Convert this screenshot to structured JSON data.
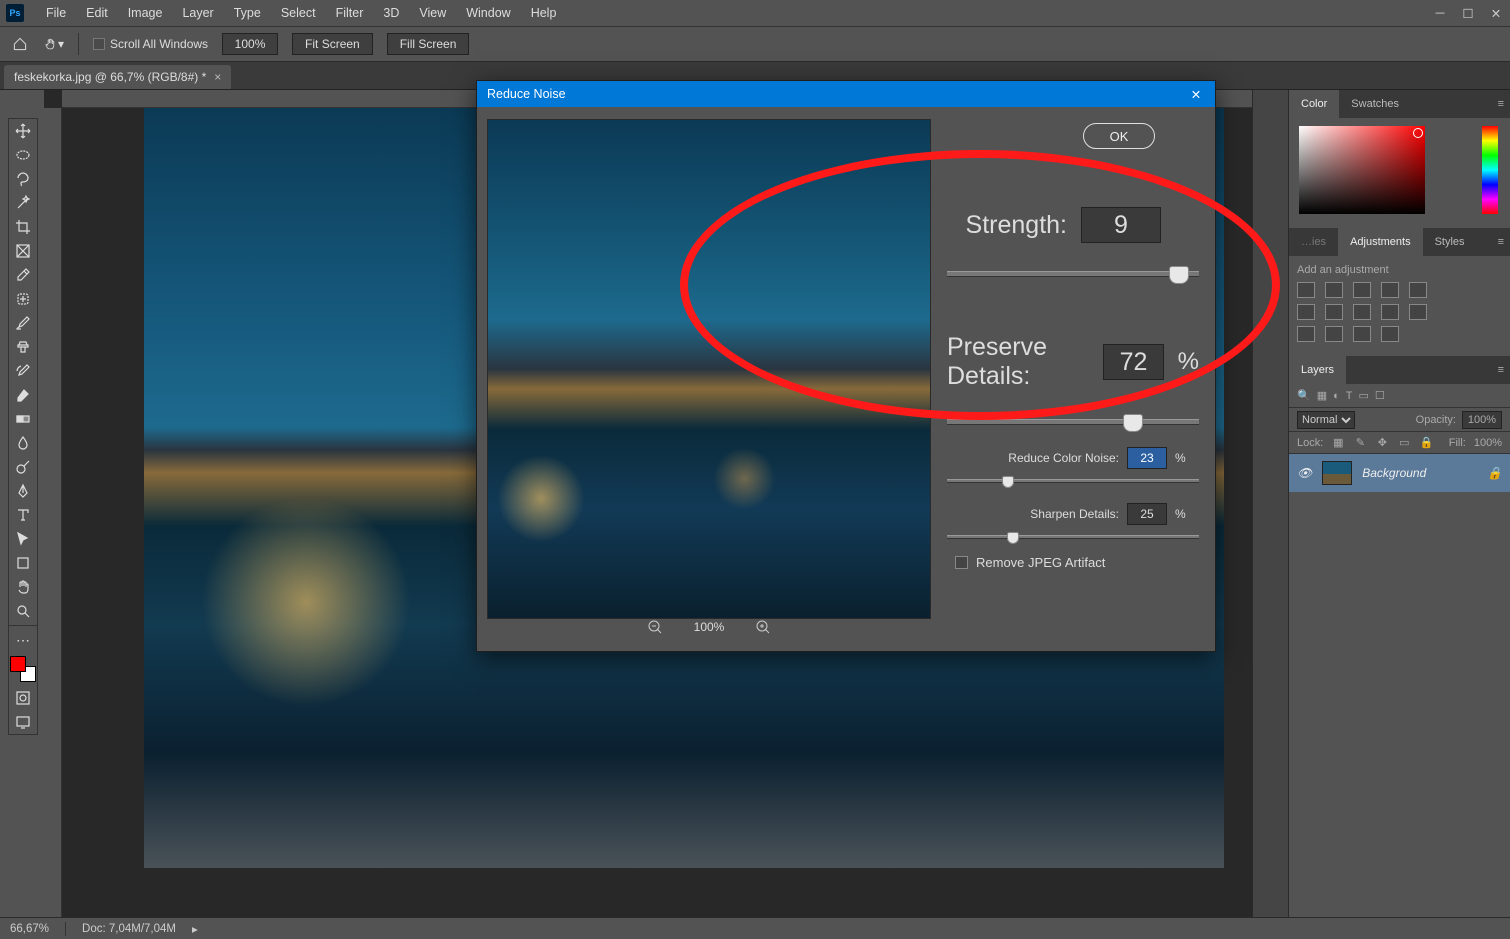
{
  "menu": {
    "items": [
      "File",
      "Edit",
      "Image",
      "Layer",
      "Type",
      "Select",
      "Filter",
      "3D",
      "View",
      "Window",
      "Help"
    ]
  },
  "optionsBar": {
    "scrollAll": "Scroll All Windows",
    "zoom": "100%",
    "fitScreen": "Fit Screen",
    "fillScreen": "Fill Screen"
  },
  "docTab": {
    "title": "feskekorka.jpg @ 66,7% (RGB/8#) *"
  },
  "dialog": {
    "title": "Reduce Noise",
    "ok": "OK",
    "previewZoom": "100%",
    "strength": {
      "label": "Strength:",
      "value": "9"
    },
    "preserveDetails": {
      "label": "Preserve Details:",
      "value": "72",
      "unit": "%"
    },
    "reduceColorNoise": {
      "label": "Reduce Color Noise:",
      "value": "23",
      "unit": "%"
    },
    "sharpenDetails": {
      "label": "Sharpen Details:",
      "value": "25",
      "unit": "%"
    },
    "removeArtifact": "Remove JPEG Artifact"
  },
  "rightPanels": {
    "colorTabs": [
      "Color",
      "Swatches"
    ],
    "adjustmentsTabs": [
      "Adjustments",
      "Styles"
    ],
    "addAdjustment": "Add an adjustment",
    "layersTabs": [
      "Layers"
    ],
    "blendMode": "Normal",
    "opacityLabel": "Opacity:",
    "opacity": "100%",
    "lockLabel": "Lock:",
    "fillLabel": "Fill:",
    "fill": "100%",
    "layerName": "Background"
  },
  "status": {
    "zoom": "66,67%",
    "docInfo": "Doc: 7,04M/7,04M"
  }
}
